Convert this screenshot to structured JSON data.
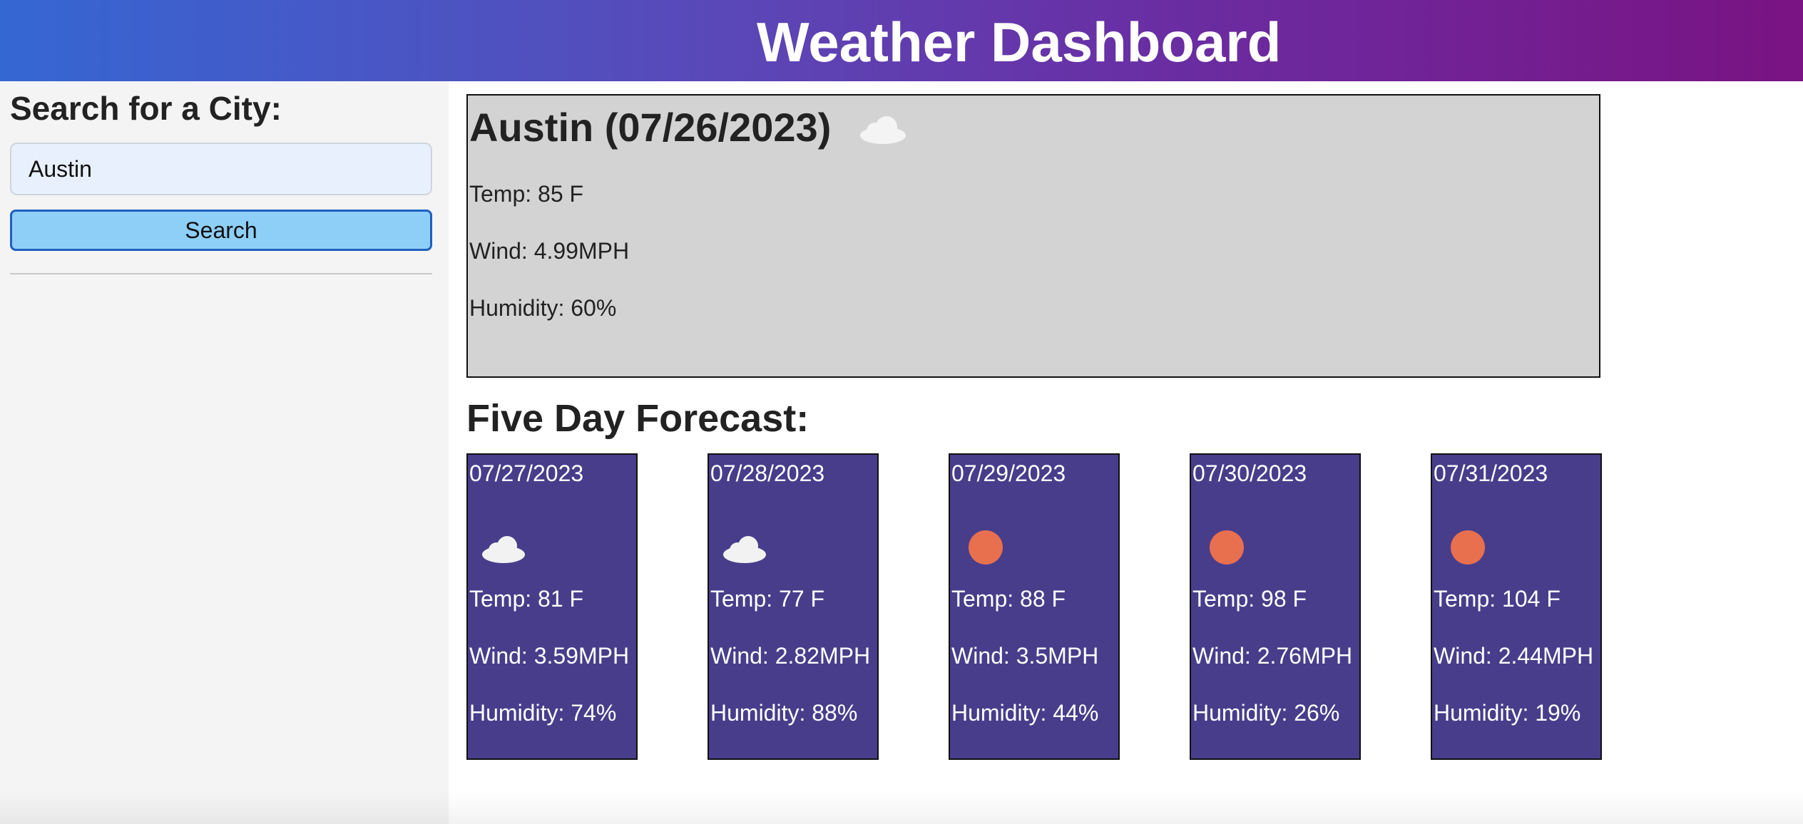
{
  "header": {
    "title": "Weather Dashboard"
  },
  "sidebar": {
    "heading": "Search for a City:",
    "search_value": "Austin",
    "search_button_label": "Search"
  },
  "current": {
    "title": "Austin (07/26/2023)",
    "icon": "cloud-icon",
    "temp": "Temp: 85 F",
    "wind": "Wind: 4.99MPH",
    "humidity": "Humidity: 60%"
  },
  "forecast": {
    "title": "Five Day Forecast:",
    "days": [
      {
        "date": "07/27/2023",
        "icon": "cloud-icon",
        "temp": "Temp: 81 F",
        "wind": "Wind: 3.59MPH",
        "humidity": "Humidity: 74%"
      },
      {
        "date": "07/28/2023",
        "icon": "cloud-icon",
        "temp": "Temp: 77 F",
        "wind": "Wind: 2.82MPH",
        "humidity": "Humidity: 88%"
      },
      {
        "date": "07/29/2023",
        "icon": "sun-icon",
        "temp": "Temp: 88 F",
        "wind": "Wind: 3.5MPH",
        "humidity": "Humidity: 44%"
      },
      {
        "date": "07/30/2023",
        "icon": "sun-icon",
        "temp": "Temp: 98 F",
        "wind": "Wind: 2.76MPH",
        "humidity": "Humidity: 26%"
      },
      {
        "date": "07/31/2023",
        "icon": "sun-icon",
        "temp": "Temp: 104 F",
        "wind": "Wind: 2.44MPH",
        "humidity": "Humidity: 19%"
      }
    ]
  },
  "colors": {
    "header_gradient_start": "#3567d3",
    "header_gradient_end": "#7a1383",
    "current_card_bg": "#d3d3d3",
    "forecast_card_bg": "#483d8b",
    "search_button_bg": "#8ecff8",
    "sun_color": "#e8704e"
  }
}
